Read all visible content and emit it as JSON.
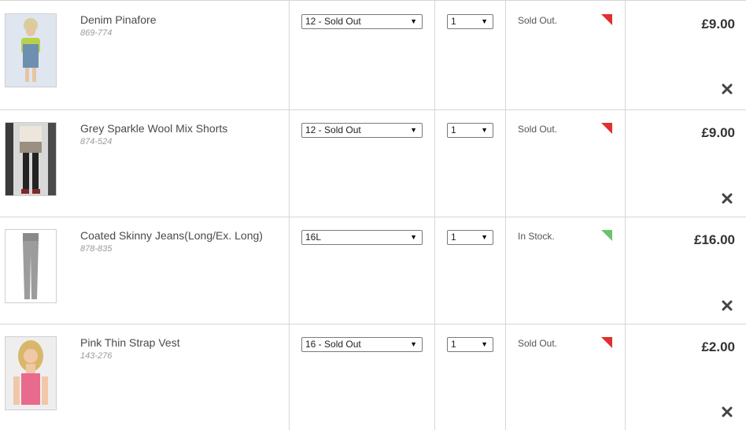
{
  "items": [
    {
      "name": "Denim Pinafore",
      "code": "869-774",
      "size": "12 - Sold Out",
      "qty": "1",
      "stock": "Sold Out.",
      "stock_state": "sold-out",
      "price": "£9.00"
    },
    {
      "name": "Grey Sparkle Wool Mix Shorts",
      "code": "874-524",
      "size": "12 - Sold Out",
      "qty": "1",
      "stock": "Sold Out.",
      "stock_state": "sold-out",
      "price": "£9.00"
    },
    {
      "name": "Coated Skinny Jeans(Long/Ex. Long)",
      "code": "878-835",
      "size": "16L",
      "qty": "1",
      "stock": "In Stock.",
      "stock_state": "in-stock",
      "price": "£16.00"
    },
    {
      "name": "Pink Thin Strap Vest",
      "code": "143-276",
      "size": "16 - Sold Out",
      "qty": "1",
      "stock": "Sold Out.",
      "stock_state": "sold-out",
      "price": "£2.00"
    }
  ],
  "colors": {
    "sold_out_flag": "#e03030",
    "in_stock_flag": "#6cc36a"
  },
  "icons": {
    "dropdown": "triangle-down-icon",
    "remove": "close-icon"
  }
}
